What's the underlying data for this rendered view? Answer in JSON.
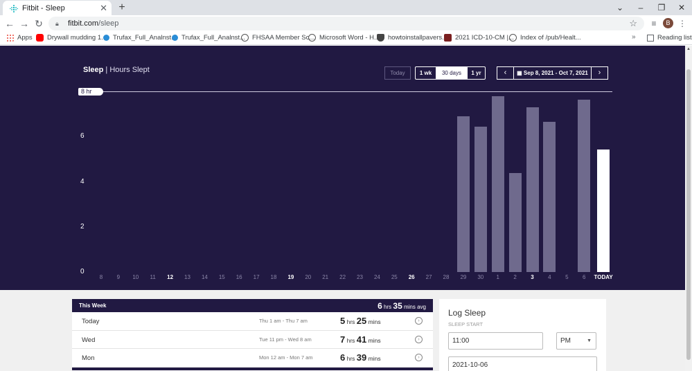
{
  "browser": {
    "tab_title": "Fitbit - Sleep",
    "url_host": "fitbit.com",
    "url_path": "/sleep",
    "avatar_initial": "B",
    "bookmarks": [
      {
        "label": "Apps",
        "color": "#e84a3a"
      },
      {
        "label": "Drywall mudding 1...",
        "color": "#ff0000"
      },
      {
        "label": "Trufax_Full_Analnst...",
        "color": "#2a8dd6"
      },
      {
        "label": "Trufax_Full_Analnst...",
        "color": "#2a8dd6"
      },
      {
        "label": "FHSAA Member Sc...",
        "color": "#555555"
      },
      {
        "label": "Microsoft Word - H...",
        "color": "#555555"
      },
      {
        "label": "howtoinstallpavers....",
        "color": "#444444"
      },
      {
        "label": "2021 ICD-10-CM |...",
        "color": "#7a1f1f"
      },
      {
        "label": "Index of /pub/Healt...",
        "color": "#555555"
      }
    ],
    "reading_list": "Reading list"
  },
  "sleep": {
    "title": "Sleep",
    "subtitle": "Hours Slept",
    "buttons": {
      "today": "Today",
      "one_week": "1 wk",
      "thirty_days": "30 days",
      "one_year": "1 yr"
    },
    "date_range": "Sep 8, 2021 - Oct 7, 2021",
    "goal_label": "8 hr",
    "colors": {
      "background": "#211942",
      "bar": "#6f6a8d",
      "today_bar": "#ffffff"
    }
  },
  "chart_data": {
    "type": "bar",
    "title": "Hours Slept",
    "categories": [
      "8",
      "9",
      "10",
      "11",
      "12",
      "13",
      "14",
      "15",
      "16",
      "17",
      "18",
      "19",
      "20",
      "21",
      "22",
      "23",
      "24",
      "25",
      "26",
      "27",
      "28",
      "29",
      "30",
      "1",
      "2",
      "3",
      "4",
      "5",
      "6",
      "TODAY"
    ],
    "bold_categories": [
      "12",
      "19",
      "26",
      "3",
      "TODAY"
    ],
    "values": [
      0,
      0,
      0,
      0,
      0,
      0,
      0,
      0,
      0,
      0,
      0,
      0,
      0,
      0,
      0,
      0,
      0,
      0,
      0,
      0,
      0,
      6.9,
      6.45,
      7.8,
      4.4,
      7.3,
      6.65,
      0,
      7.65,
      5.42
    ],
    "yticks": [
      0,
      2,
      4,
      6
    ],
    "ylim": [
      0,
      8
    ],
    "goal": 8,
    "grid": false
  },
  "this_week": {
    "label": "This Week",
    "avg_hrs": "6",
    "avg_hrs_unit": "hrs",
    "avg_mins": "35",
    "avg_mins_unit": "mins avg",
    "rows": [
      {
        "day": "Today",
        "range": "Thu 1 am - Thu 7 am",
        "hrs": "5",
        "mins": "25"
      },
      {
        "day": "Wed",
        "range": "Tue 11 pm - Wed 8 am",
        "hrs": "7",
        "mins": "41"
      },
      {
        "day": "Mon",
        "range": "Mon 12 am - Mon 7 am",
        "hrs": "6",
        "mins": "39"
      }
    ],
    "hrs_unit": "hrs",
    "mins_unit": "mins"
  },
  "log_sleep": {
    "title": "Log Sleep",
    "start_label": "SLEEP START",
    "time_value": "11:00",
    "ampm_value": "PM",
    "date_value": "2021-10-06"
  }
}
